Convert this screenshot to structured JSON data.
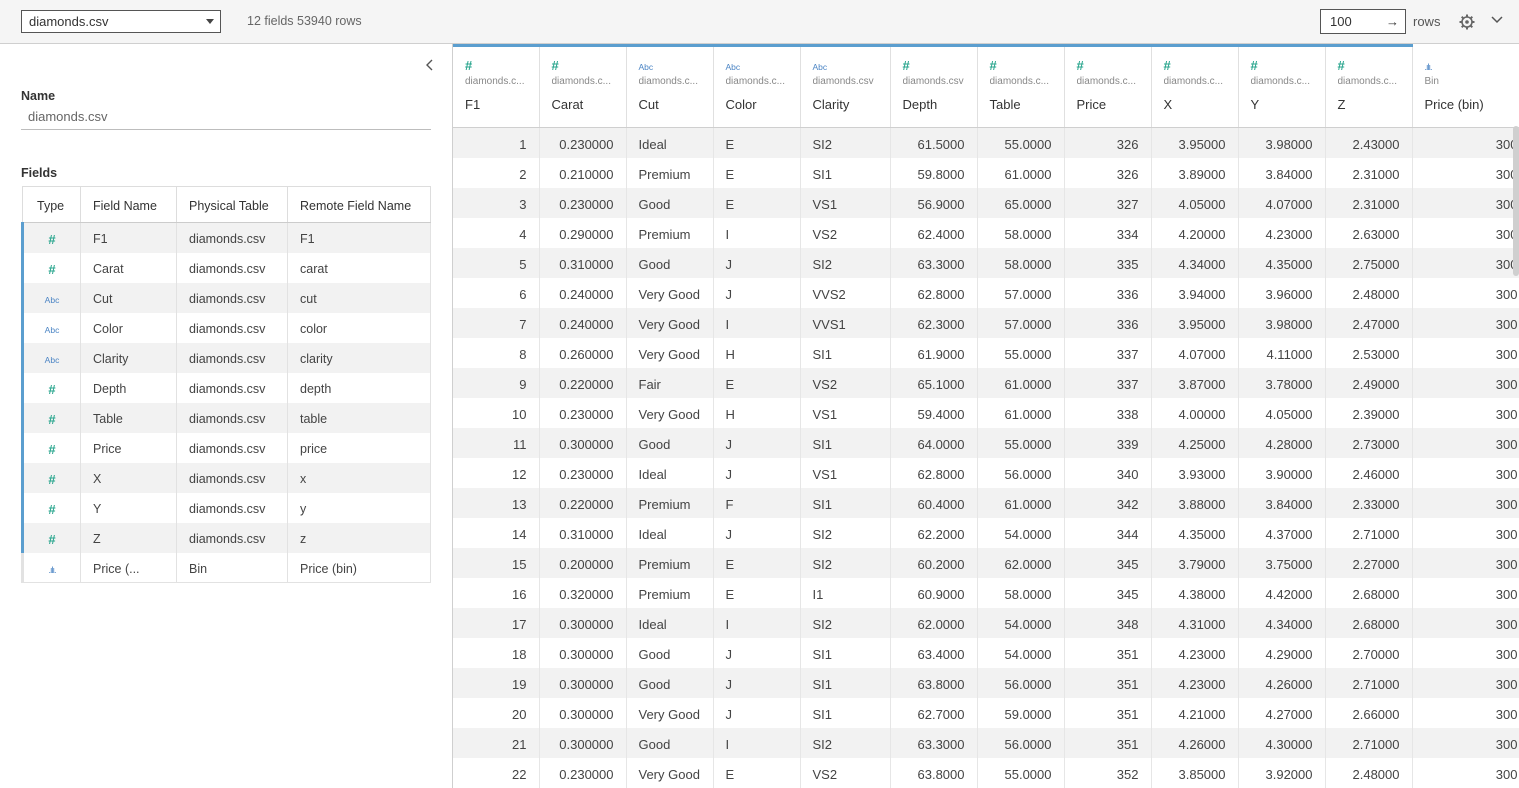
{
  "topbar": {
    "datasource": "diamonds.csv",
    "summary": "12 fields 53940 rows",
    "rows_value": "100",
    "rows_arrow": "→",
    "rows_label": "rows"
  },
  "left": {
    "collapse_glyph": "‹",
    "name_label": "Name",
    "name_value": "diamonds.csv",
    "fields_label": "Fields",
    "columns": [
      "Type",
      "Field Name",
      "Physical Table",
      "Remote Field Name"
    ],
    "fields": [
      {
        "icon": "#",
        "kind": "number",
        "name": "F1",
        "table": "diamonds.csv",
        "remote": "F1"
      },
      {
        "icon": "#",
        "kind": "number",
        "name": "Carat",
        "table": "diamonds.csv",
        "remote": "carat"
      },
      {
        "icon": "Abc",
        "kind": "string",
        "name": "Cut",
        "table": "diamonds.csv",
        "remote": "cut"
      },
      {
        "icon": "Abc",
        "kind": "string",
        "name": "Color",
        "table": "diamonds.csv",
        "remote": "color"
      },
      {
        "icon": "Abc",
        "kind": "string",
        "name": "Clarity",
        "table": "diamonds.csv",
        "remote": "clarity"
      },
      {
        "icon": "#",
        "kind": "number",
        "name": "Depth",
        "table": "diamonds.csv",
        "remote": "depth"
      },
      {
        "icon": "#",
        "kind": "number",
        "name": "Table",
        "table": "diamonds.csv",
        "remote": "table"
      },
      {
        "icon": "#",
        "kind": "number",
        "name": "Price",
        "table": "diamonds.csv",
        "remote": "price"
      },
      {
        "icon": "#",
        "kind": "number",
        "name": "X",
        "table": "diamonds.csv",
        "remote": "x"
      },
      {
        "icon": "#",
        "kind": "number",
        "name": "Y",
        "table": "diamonds.csv",
        "remote": "y"
      },
      {
        "icon": "#",
        "kind": "number",
        "name": "Z",
        "table": "diamonds.csv",
        "remote": "z"
      },
      {
        "icon": ".ılı.",
        "kind": "bin",
        "name": "Price (...",
        "table": "Bin",
        "remote": "Price (bin)"
      }
    ]
  },
  "grid": {
    "columns": [
      {
        "icon": "#",
        "kind": "number",
        "source": "diamonds.c...",
        "name": "F1",
        "align": "num"
      },
      {
        "icon": "#",
        "kind": "number",
        "source": "diamonds.c...",
        "name": "Carat",
        "align": "num"
      },
      {
        "icon": "Abc",
        "kind": "string",
        "source": "diamonds.c...",
        "name": "Cut",
        "align": "str"
      },
      {
        "icon": "Abc",
        "kind": "string",
        "source": "diamonds.c...",
        "name": "Color",
        "align": "str"
      },
      {
        "icon": "Abc",
        "kind": "string",
        "source": "diamonds.csv",
        "name": "Clarity",
        "align": "str"
      },
      {
        "icon": "#",
        "kind": "number",
        "source": "diamonds.csv",
        "name": "Depth",
        "align": "num"
      },
      {
        "icon": "#",
        "kind": "number",
        "source": "diamonds.c...",
        "name": "Table",
        "align": "num"
      },
      {
        "icon": "#",
        "kind": "number",
        "source": "diamonds.c...",
        "name": "Price",
        "align": "num"
      },
      {
        "icon": "#",
        "kind": "number",
        "source": "diamonds.c...",
        "name": "X",
        "align": "num"
      },
      {
        "icon": "#",
        "kind": "number",
        "source": "diamonds.c...",
        "name": "Y",
        "align": "num"
      },
      {
        "icon": "#",
        "kind": "number",
        "source": "diamonds.c...",
        "name": "Z",
        "align": "num"
      },
      {
        "icon": ".ılı.",
        "kind": "bin",
        "source": "Bin",
        "name": "Price (bin)",
        "align": "num"
      }
    ],
    "rows": [
      [
        "1",
        "0.230000",
        "Ideal",
        "E",
        "SI2",
        "61.5000",
        "55.0000",
        "326",
        "3.95000",
        "3.98000",
        "2.43000",
        "300"
      ],
      [
        "2",
        "0.210000",
        "Premium",
        "E",
        "SI1",
        "59.8000",
        "61.0000",
        "326",
        "3.89000",
        "3.84000",
        "2.31000",
        "300"
      ],
      [
        "3",
        "0.230000",
        "Good",
        "E",
        "VS1",
        "56.9000",
        "65.0000",
        "327",
        "4.05000",
        "4.07000",
        "2.31000",
        "300"
      ],
      [
        "4",
        "0.290000",
        "Premium",
        "I",
        "VS2",
        "62.4000",
        "58.0000",
        "334",
        "4.20000",
        "4.23000",
        "2.63000",
        "300"
      ],
      [
        "5",
        "0.310000",
        "Good",
        "J",
        "SI2",
        "63.3000",
        "58.0000",
        "335",
        "4.34000",
        "4.35000",
        "2.75000",
        "300"
      ],
      [
        "6",
        "0.240000",
        "Very Good",
        "J",
        "VVS2",
        "62.8000",
        "57.0000",
        "336",
        "3.94000",
        "3.96000",
        "2.48000",
        "300"
      ],
      [
        "7",
        "0.240000",
        "Very Good",
        "I",
        "VVS1",
        "62.3000",
        "57.0000",
        "336",
        "3.95000",
        "3.98000",
        "2.47000",
        "300"
      ],
      [
        "8",
        "0.260000",
        "Very Good",
        "H",
        "SI1",
        "61.9000",
        "55.0000",
        "337",
        "4.07000",
        "4.11000",
        "2.53000",
        "300"
      ],
      [
        "9",
        "0.220000",
        "Fair",
        "E",
        "VS2",
        "65.1000",
        "61.0000",
        "337",
        "3.87000",
        "3.78000",
        "2.49000",
        "300"
      ],
      [
        "10",
        "0.230000",
        "Very Good",
        "H",
        "VS1",
        "59.4000",
        "61.0000",
        "338",
        "4.00000",
        "4.05000",
        "2.39000",
        "300"
      ],
      [
        "11",
        "0.300000",
        "Good",
        "J",
        "SI1",
        "64.0000",
        "55.0000",
        "339",
        "4.25000",
        "4.28000",
        "2.73000",
        "300"
      ],
      [
        "12",
        "0.230000",
        "Ideal",
        "J",
        "VS1",
        "62.8000",
        "56.0000",
        "340",
        "3.93000",
        "3.90000",
        "2.46000",
        "300"
      ],
      [
        "13",
        "0.220000",
        "Premium",
        "F",
        "SI1",
        "60.4000",
        "61.0000",
        "342",
        "3.88000",
        "3.84000",
        "2.33000",
        "300"
      ],
      [
        "14",
        "0.310000",
        "Ideal",
        "J",
        "SI2",
        "62.2000",
        "54.0000",
        "344",
        "4.35000",
        "4.37000",
        "2.71000",
        "300"
      ],
      [
        "15",
        "0.200000",
        "Premium",
        "E",
        "SI2",
        "60.2000",
        "62.0000",
        "345",
        "3.79000",
        "3.75000",
        "2.27000",
        "300"
      ],
      [
        "16",
        "0.320000",
        "Premium",
        "E",
        "I1",
        "60.9000",
        "58.0000",
        "345",
        "4.38000",
        "4.42000",
        "2.68000",
        "300"
      ],
      [
        "17",
        "0.300000",
        "Ideal",
        "I",
        "SI2",
        "62.0000",
        "54.0000",
        "348",
        "4.31000",
        "4.34000",
        "2.68000",
        "300"
      ],
      [
        "18",
        "0.300000",
        "Good",
        "J",
        "SI1",
        "63.4000",
        "54.0000",
        "351",
        "4.23000",
        "4.29000",
        "2.70000",
        "300"
      ],
      [
        "19",
        "0.300000",
        "Good",
        "J",
        "SI1",
        "63.8000",
        "56.0000",
        "351",
        "4.23000",
        "4.26000",
        "2.71000",
        "300"
      ],
      [
        "20",
        "0.300000",
        "Very Good",
        "J",
        "SI1",
        "62.7000",
        "59.0000",
        "351",
        "4.21000",
        "4.27000",
        "2.66000",
        "300"
      ],
      [
        "21",
        "0.300000",
        "Good",
        "I",
        "SI2",
        "63.3000",
        "56.0000",
        "351",
        "4.26000",
        "4.30000",
        "2.71000",
        "300"
      ],
      [
        "22",
        "0.230000",
        "Very Good",
        "E",
        "VS2",
        "63.8000",
        "55.0000",
        "352",
        "3.85000",
        "3.92000",
        "2.48000",
        "300"
      ]
    ]
  },
  "colors": {
    "accent_blue": "#5b9ecf",
    "number_icon": "#2aa68e",
    "string_icon": "#4a84c4",
    "stripe": "#f2f2f2",
    "topbar_bg": "#f5f5f5"
  }
}
